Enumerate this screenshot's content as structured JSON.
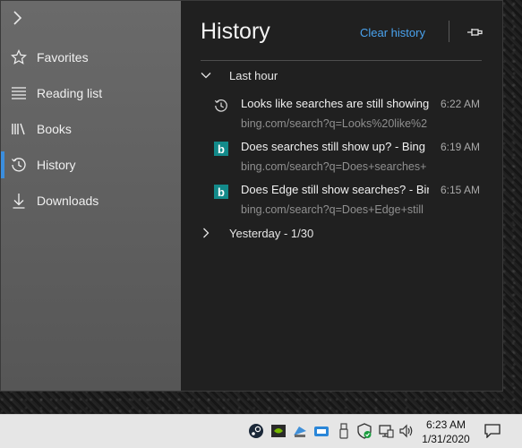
{
  "sidebar": {
    "items": [
      {
        "label": "Favorites",
        "icon": "star-icon"
      },
      {
        "label": "Reading list",
        "icon": "reading-list-icon"
      },
      {
        "label": "Books",
        "icon": "books-icon"
      },
      {
        "label": "History",
        "icon": "history-icon",
        "active": true
      },
      {
        "label": "Downloads",
        "icon": "download-icon"
      }
    ]
  },
  "panel": {
    "title": "History",
    "clear_label": "Clear history",
    "groups": [
      {
        "label": "Last hour",
        "expanded": true
      },
      {
        "label": "Yesterday - 1/30",
        "expanded": false
      }
    ],
    "entries": [
      {
        "icon": "history-icon",
        "title": "Looks like searches are still showing",
        "url": "bing.com/search?q=Looks%20like%2",
        "time": "6:22 AM"
      },
      {
        "icon": "bing-icon",
        "title": "Does searches still show up? - Bing",
        "url": "bing.com/search?q=Does+searches+",
        "time": "6:19 AM"
      },
      {
        "icon": "bing-icon",
        "title": "Does Edge still show searches? - Bing",
        "url": "bing.com/search?q=Does+Edge+still",
        "time": "6:15 AM"
      }
    ]
  },
  "taskbar": {
    "time": "6:23 AM",
    "date": "1/31/2020",
    "tray_icons": [
      "steam-icon",
      "nvidia-icon",
      "network-share-icon",
      "keyboard-icon",
      "usb-icon",
      "defender-icon",
      "network-icon",
      "volume-icon"
    ]
  },
  "colors": {
    "accent": "#3b8ede",
    "link": "#4aa3ef",
    "bing": "#138a8a"
  }
}
